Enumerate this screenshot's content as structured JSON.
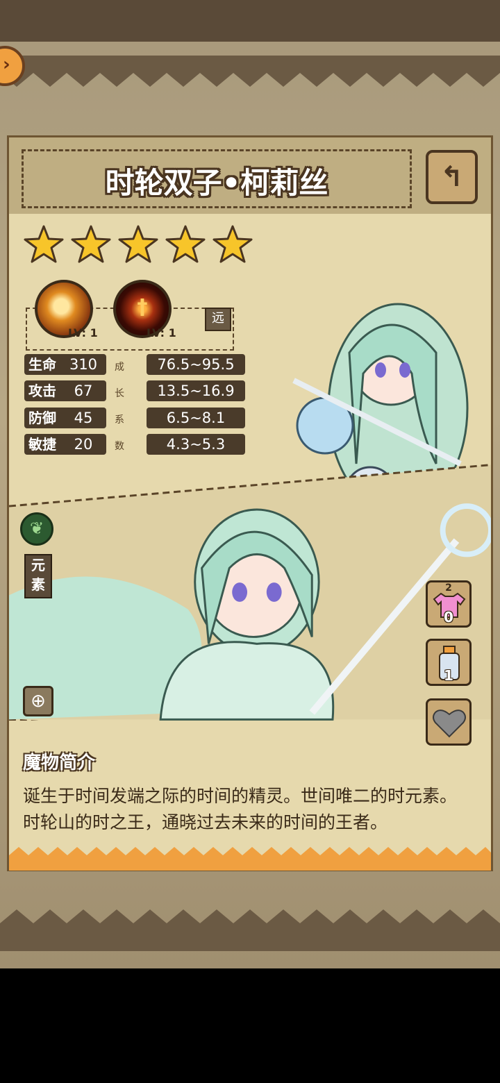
{
  "monster": {
    "name": "时轮双子•柯莉丝",
    "star_count": 5,
    "range_badge": "远"
  },
  "skills": [
    {
      "level": "LV: 1"
    },
    {
      "level": "LV: 1"
    }
  ],
  "stats": [
    {
      "label": "生命",
      "value": "310",
      "growth": "76.5~95.5"
    },
    {
      "label": "攻击",
      "value": "67",
      "growth": "13.5~16.9"
    },
    {
      "label": "防御",
      "value": "45",
      "growth": "6.5~8.1"
    },
    {
      "label": "敏捷",
      "value": "20",
      "growth": "4.3~5.3"
    }
  ],
  "growth_chars": [
    "成",
    "长",
    "系",
    "数"
  ],
  "element": {
    "label": "元素"
  },
  "side_buttons": {
    "costume_top_count": "2",
    "costume_count": "0",
    "bottle_count": "1"
  },
  "description": {
    "title": "魔物简介",
    "text": "诞生于时间发端之际的时间的精灵。世间唯二的时元素。时轮山的时之王，通晓过去未来的时间的王者。"
  },
  "colors": {
    "panel": "#e6d9ad",
    "frame": "#6e5532",
    "stat_bg": "#4a3b2a",
    "star": "#f7c52a"
  }
}
